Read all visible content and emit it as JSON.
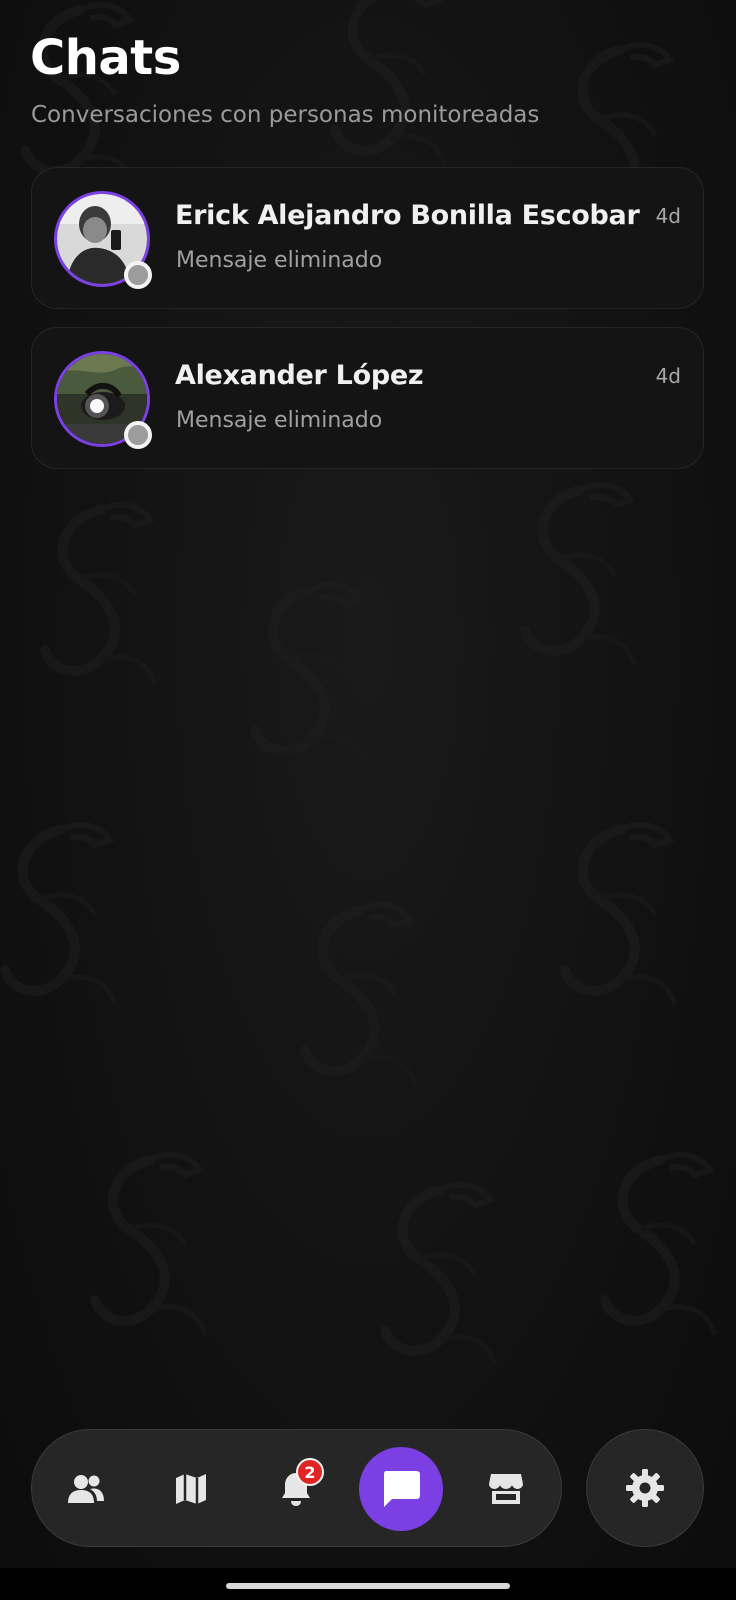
{
  "header": {
    "title": "Chats",
    "subtitle": "Conversaciones con personas monitoreadas"
  },
  "chats": [
    {
      "name": "Erick Alejandro Bonilla Escobar",
      "preview": "Mensaje eliminado",
      "time": "4d",
      "status": "offline"
    },
    {
      "name": "Alexander López",
      "preview": "Mensaje eliminado",
      "time": "4d",
      "status": "offline"
    }
  ],
  "nav": {
    "items": [
      {
        "icon": "users-icon"
      },
      {
        "icon": "map-icon"
      },
      {
        "icon": "bell-icon",
        "badge": "2"
      },
      {
        "icon": "chat-icon",
        "active": true
      },
      {
        "icon": "store-icon"
      }
    ],
    "settings_icon": "gear-icon"
  },
  "colors": {
    "accent": "#7b3fe4",
    "badge": "#e02424",
    "background": "#121212",
    "card": "#141414"
  }
}
